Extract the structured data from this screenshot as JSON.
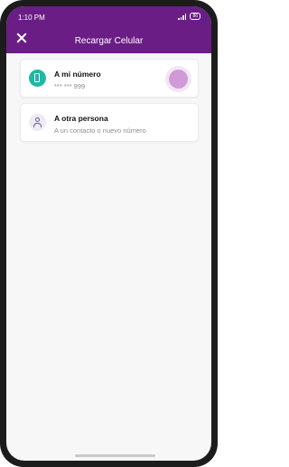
{
  "status_bar": {
    "time": "1:10 PM",
    "battery": "86"
  },
  "appbar": {
    "title": "Recargar Celular",
    "close_icon": "close-icon"
  },
  "options": [
    {
      "label": "A mi número",
      "subtitle": "*** *** 999",
      "icon": "phone-icon",
      "icon_color": "#1fb8a6"
    },
    {
      "label": "A otra persona",
      "subtitle": "A un contacto o nuevo número",
      "icon": "person-icon",
      "icon_color": "#eeeaf6"
    }
  ],
  "colors": {
    "brand": "#6a1d84",
    "accent_teal": "#1fb8a6",
    "ripple": "#cf9ad6"
  }
}
